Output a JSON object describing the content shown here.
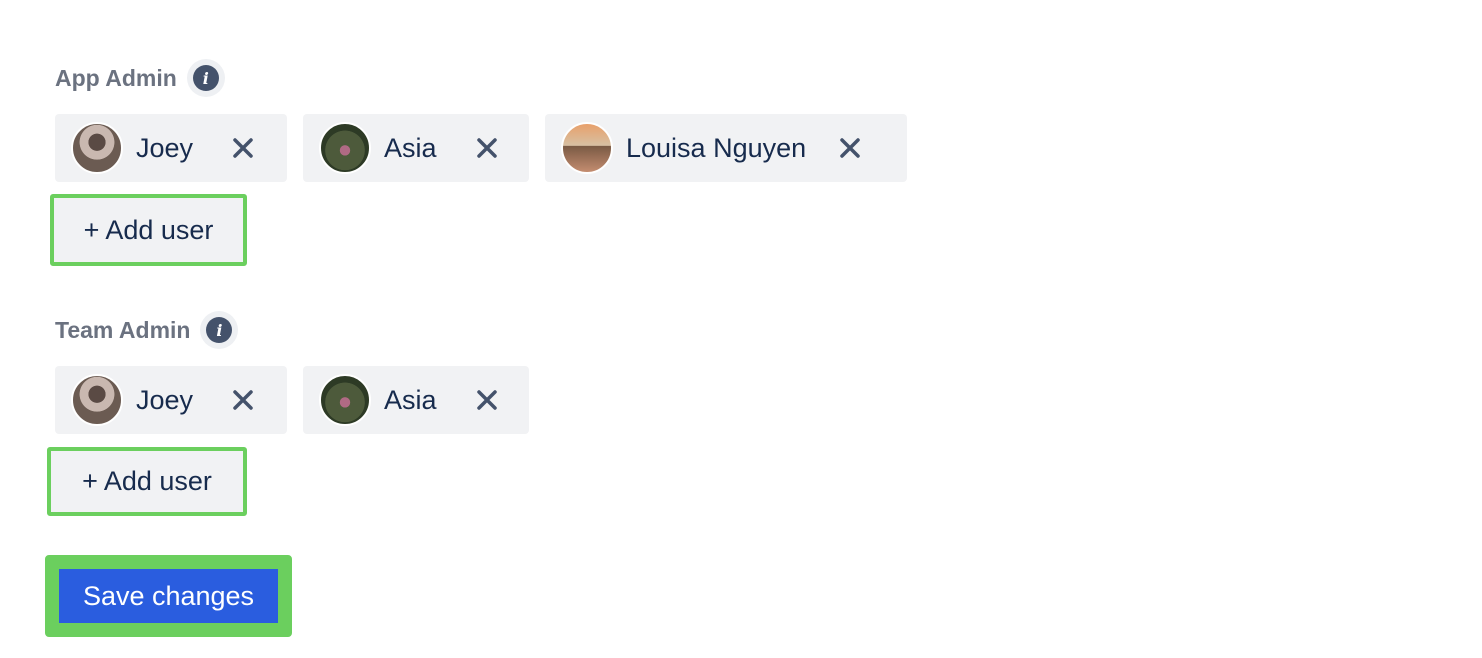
{
  "sections": [
    {
      "label": "App Admin",
      "users": [
        {
          "name": "Joey"
        },
        {
          "name": "Asia"
        },
        {
          "name": "Louisa Nguyen"
        }
      ],
      "add_label": "+ Add user"
    },
    {
      "label": "Team Admin",
      "users": [
        {
          "name": "Joey"
        },
        {
          "name": "Asia"
        }
      ],
      "add_label": "+ Add user"
    }
  ],
  "save_label": "Save changes",
  "icons": {
    "info": "info-icon",
    "remove": "close-icon"
  },
  "colors": {
    "primary": "#2a5ddf",
    "highlight": "#6bcf5e",
    "chip_bg": "#f1f2f4",
    "text": "#172b4d",
    "label": "#6b7280"
  }
}
